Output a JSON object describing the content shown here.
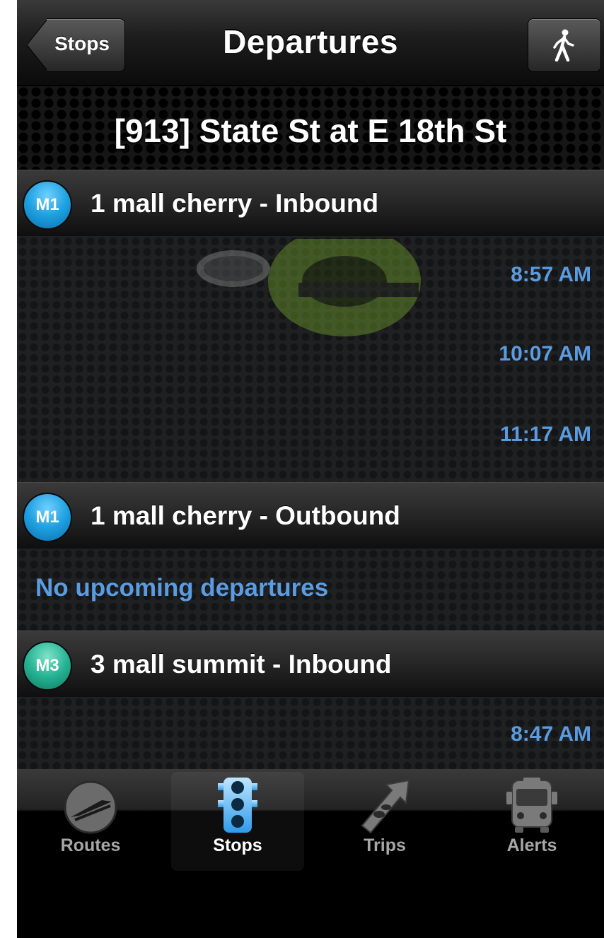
{
  "nav": {
    "title": "Departures",
    "back_label": "Stops",
    "walk_icon": "pedestrian-icon"
  },
  "stop": {
    "title": "[913] State St at E 18th St"
  },
  "sections": [
    {
      "badge": "M1",
      "badge_color": "#1ea0e0",
      "title": "1 mall cherry - Inbound",
      "times": [
        "8:57 AM",
        "10:07 AM",
        "11:17 AM"
      ]
    },
    {
      "badge": "M1",
      "badge_color": "#1ea0e0",
      "title": "1 mall cherry - Outbound",
      "message": "No upcoming departures"
    },
    {
      "badge": "M3",
      "badge_color": "#26b393",
      "title": "3 mall summit - Inbound",
      "times": [
        "8:47 AM"
      ]
    }
  ],
  "tabs": [
    {
      "label": "Routes",
      "icon": "route-sign-icon",
      "active": false
    },
    {
      "label": "Stops",
      "icon": "traffic-light-icon",
      "active": true
    },
    {
      "label": "Trips",
      "icon": "trip-arrow-icon",
      "active": false
    },
    {
      "label": "Alerts",
      "icon": "bus-icon",
      "active": false
    }
  ],
  "colors": {
    "time_text": "#5b9be0",
    "active_tab_icon": "#3fa9f5"
  }
}
